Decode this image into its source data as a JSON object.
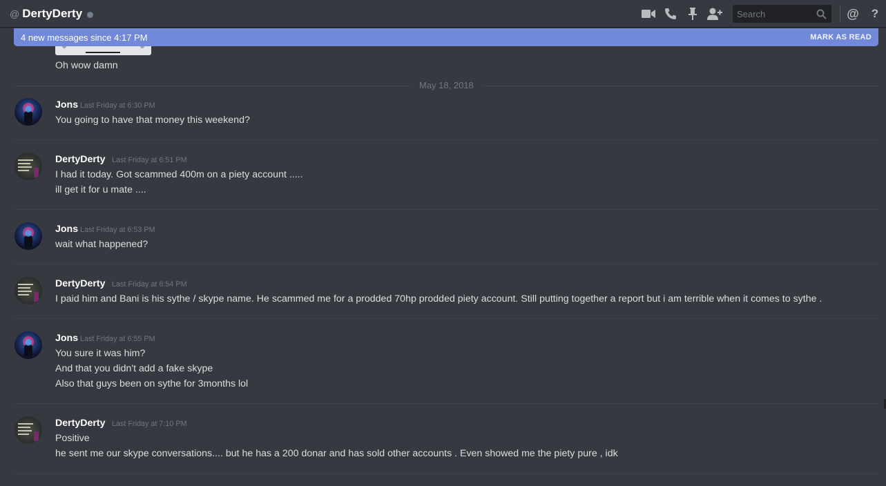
{
  "header": {
    "at_symbol": "@",
    "channel_name": "DertyDerty",
    "search_placeholder": "Search",
    "mention_symbol": "@",
    "help_symbol": "?"
  },
  "icons": [
    "video-call-icon",
    "voice-call-icon",
    "pin-icon",
    "add-friend-icon",
    "search-icon",
    "mention-icon",
    "help-icon"
  ],
  "new_messages": {
    "text": "4 new messages since 4:17 PM",
    "mark_label": "MARK AS READ"
  },
  "previous_message": {
    "text": "Oh wow damn"
  },
  "date_divider": "May 18, 2018",
  "messages": [
    {
      "author": "Jons",
      "timestamp": "Last Friday at 6:30 PM",
      "lines": [
        "You going to have that money this weekend?"
      ]
    },
    {
      "author": "DertyDerty",
      "timestamp": "Last Friday at 6:51 PM",
      "lines": [
        "I had it today. Got scammed 400m on a piety account .....",
        "ill get it for u mate ...."
      ]
    },
    {
      "author": "Jons",
      "timestamp": "Last Friday at 6:53 PM",
      "lines": [
        "wait what happened?"
      ]
    },
    {
      "author": "DertyDerty",
      "timestamp": "Last Friday at 6:54 PM",
      "lines": [
        "I paid him and Bani is his sythe / skype name. He scammed me for a prodded 70hp prodded piety account. Still putting together a report but i am terrible when it comes to sythe ."
      ]
    },
    {
      "author": "Jons",
      "timestamp": "Last Friday at 6:55 PM",
      "lines": [
        "You sure it was him?",
        "And that you didn't add a fake skype",
        "Also that guys been on sythe for 3months lol"
      ]
    },
    {
      "author": "DertyDerty",
      "timestamp": "Last Friday at 7:10 PM",
      "lines": [
        "Positive",
        "he sent me our skype conversations.... but he has a 200 donar and has sold other accounts . Even showed me the piety pure , idk"
      ]
    }
  ],
  "colors": {
    "background": "#36393f",
    "header_text": "#ffffff",
    "accent_blurple": "#7289da",
    "muted_text": "#72767d",
    "message_text": "#dcddde"
  }
}
